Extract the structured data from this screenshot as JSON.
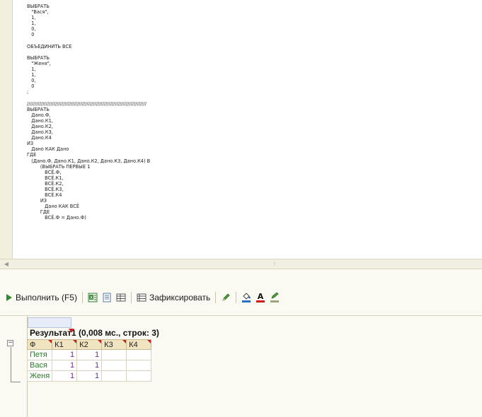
{
  "editor": {
    "code": "ВЫБРАТЬ\n   \"Вася\",\n   1,\n   1,\n   0,\n   0\n\nОБЪЕДИНИТЬ ВСЕ\n\nВЫБРАТЬ\n   \"Женя\",\n   1,\n   1,\n   0,\n   0\n;\n\n////////////////////////////////////////////////////////////////////////////\nВЫБРАТЬ\n   Дано.Ф,\n   Дано.К1,\n   Дано.К2,\n   Дано.К3,\n   Дано.К4\nИЗ\n   Дано КАК Дано\nГДЕ\n   (Дано.Ф, Дано.К1, Дано.К2, Дано.К3, Дано.К4) В\n         (ВЫБРАТЬ ПЕРВЫЕ 1\n            ВСЁ.Ф,\n            ВСЁ.К1,\n            ВСЁ.К2,\n            ВСЁ.К3,\n            ВСЁ.К4\n         ИЗ\n            Дано КАК ВСЁ\n         ГДЕ\n            ВСЁ.Ф = Дано.Ф)"
  },
  "toolbar": {
    "run_label": "Выполнить (F5)",
    "fix_label": "Зафиксировать",
    "icons": [
      "play-icon",
      "excel-export-icon",
      "text-export-icon",
      "table-icon",
      "fix-table-icon",
      "edit-icon",
      "fill-color-icon",
      "font-color-icon",
      "highlight-icon"
    ]
  },
  "results": {
    "title": "Результат1 (0,008 мс., строк: 3)",
    "columns": [
      "Ф",
      "К1",
      "К2",
      "К3",
      "К4"
    ],
    "rows": [
      {
        "f": "Петя",
        "k1": "1",
        "k2": "1",
        "k3": "",
        "k4": ""
      },
      {
        "f": "Вася",
        "k1": "1",
        "k2": "1",
        "k3": "",
        "k4": ""
      },
      {
        "f": "Женя",
        "k1": "1",
        "k2": "1",
        "k3": "",
        "k4": ""
      }
    ]
  },
  "colors": {
    "name_text": "#2a7a2a",
    "number_text": "#6a2c90",
    "header_bg": "#f1e4c0",
    "marker_red": "#c82020"
  }
}
